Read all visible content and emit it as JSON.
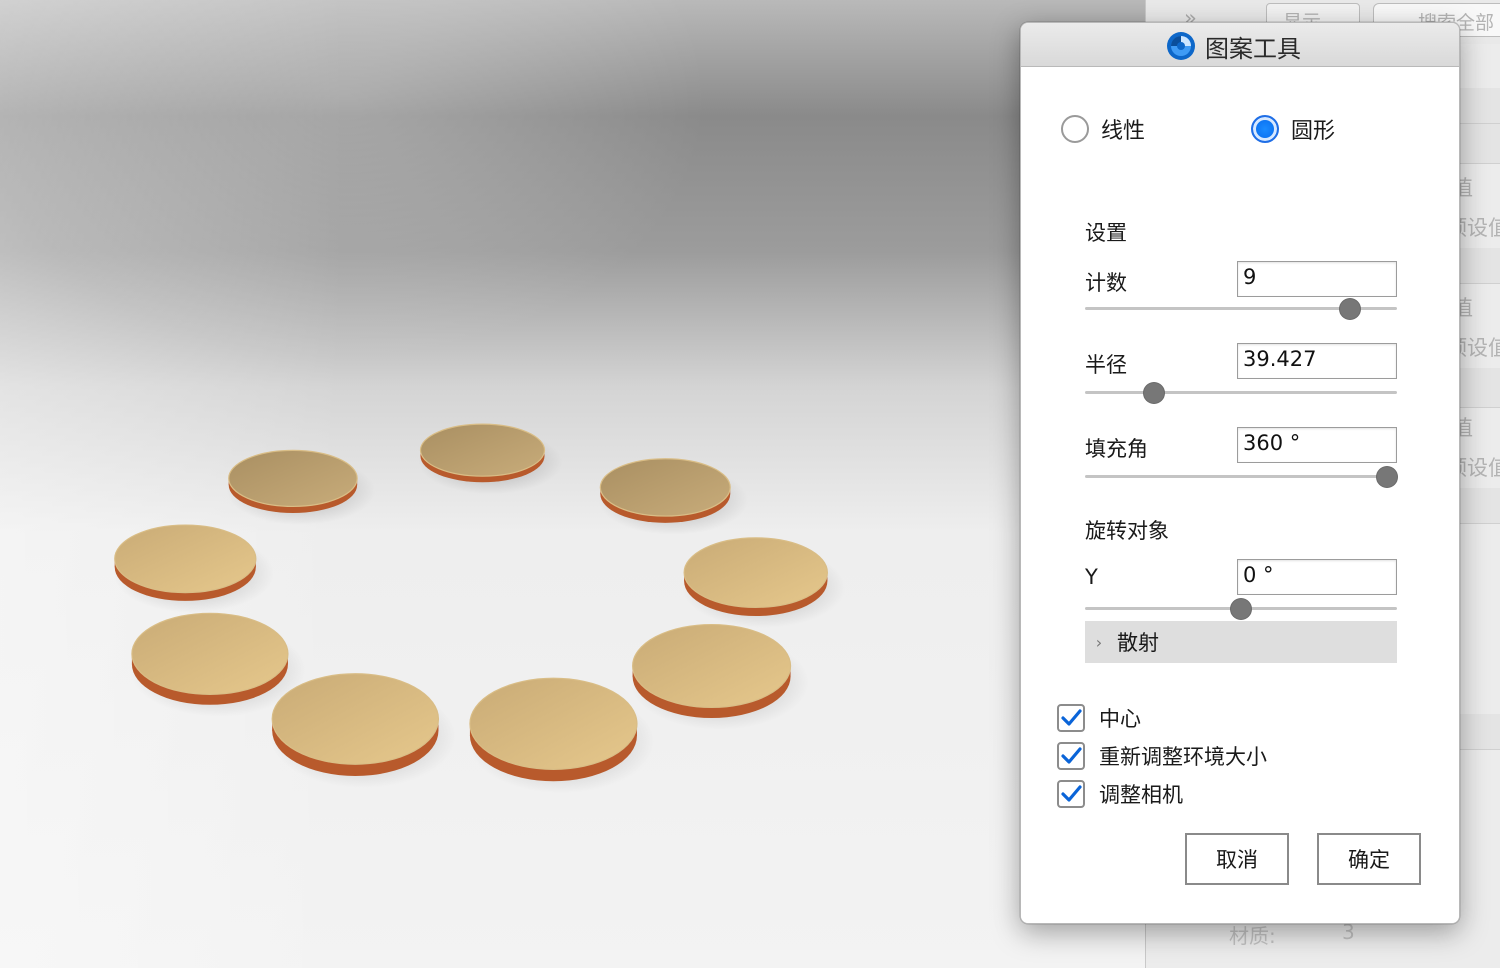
{
  "dialog": {
    "title": "图案工具",
    "mode": {
      "linear_label": "线性",
      "circular_label": "圆形",
      "selected": "circular"
    },
    "settings": {
      "section_label": "设置",
      "count_label": "计数",
      "count_value": "9",
      "count_slider_level": 0.85,
      "radius_label": "半径",
      "radius_value": "39.427",
      "radius_slider_level": 0.22,
      "fill_angle_label": "填充角",
      "fill_angle_value": "360 °",
      "fill_angle_slider_level": 1.0
    },
    "rotate": {
      "section_label": "旋转对象",
      "y_label": "Y",
      "y_value": "0 °",
      "y_slider_level": 0.5
    },
    "scatter_label": "散射",
    "options": [
      {
        "label": "中心",
        "checked": true
      },
      {
        "label": "重新调整环境大小",
        "checked": true
      },
      {
        "label": "调整相机",
        "checked": true
      }
    ],
    "cancel_label": "取消",
    "ok_label": "确定"
  },
  "background_panel": {
    "toolbar_display": "显示",
    "toolbar_search": "搜索全部",
    "value_label": "值",
    "preset_label": "预设值",
    "material_label": "材质:",
    "material_count": "3"
  },
  "scene": {
    "object_count": 9,
    "disc_color": "#e2c387",
    "disc_edge_color": "#b85a2c",
    "accent": "#0a6ff0"
  }
}
